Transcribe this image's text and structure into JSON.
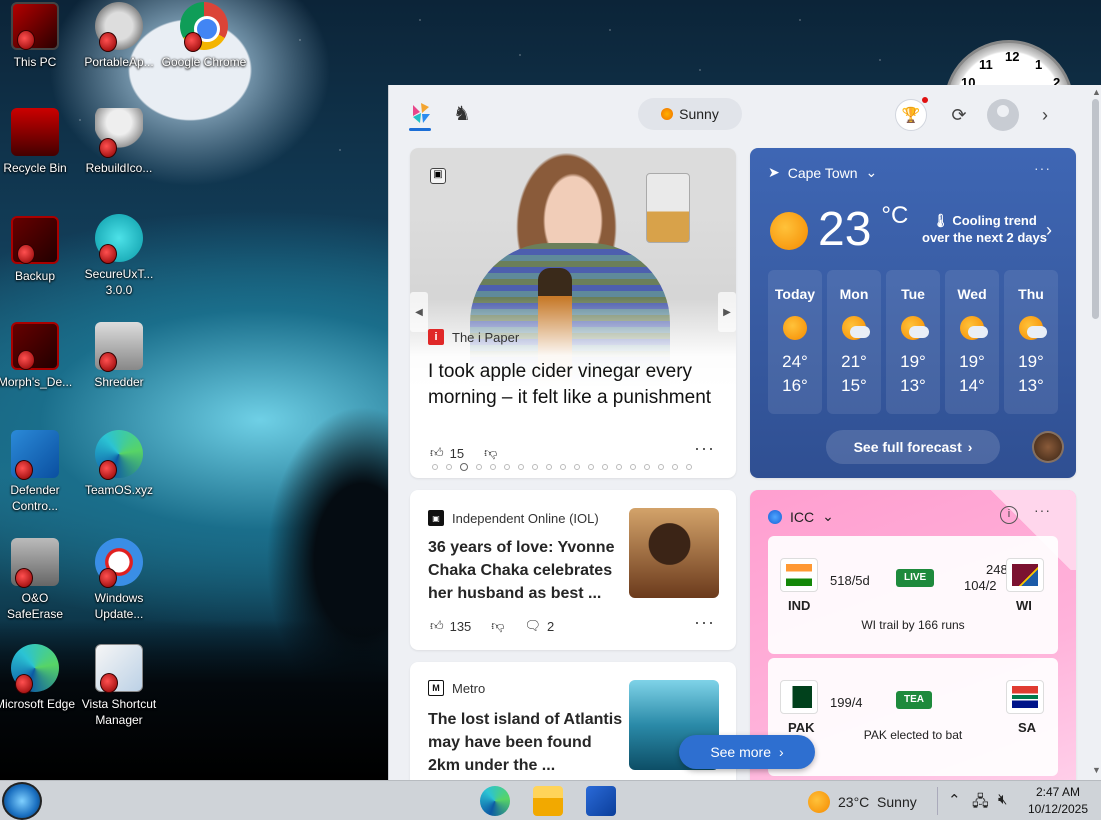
{
  "desktop": {
    "icons": [
      {
        "label": "This PC"
      },
      {
        "label": "PortableAp..."
      },
      {
        "label": "Google Chrome"
      },
      {
        "label": "Recycle Bin"
      },
      {
        "label": "RebuildIco..."
      },
      {
        "label": "Backup"
      },
      {
        "label": "SecureUxT... 3.0.0"
      },
      {
        "label": "Morph's_De..."
      },
      {
        "label": "Shredder"
      },
      {
        "label": "Defender Contro..."
      },
      {
        "label": "TeamOS.xyz"
      },
      {
        "label": "O&O SafeErase"
      },
      {
        "label": "Windows Update..."
      },
      {
        "label": "Microsoft Edge"
      },
      {
        "label": "Vista Shortcut Manager"
      }
    ],
    "clock_numbers": [
      "12",
      "11",
      "1",
      "10",
      "2"
    ]
  },
  "widgets": {
    "topbar": {
      "weather_pill": "Sunny"
    },
    "hero": {
      "source": "The i Paper",
      "headline": "I took apple cider vinegar every morning – it felt like a punishment",
      "likes": "15"
    },
    "weather": {
      "location": "Cape Town",
      "temp": "23",
      "unit": "°C",
      "trend_line1": "Cooling trend",
      "trend_line2": "over the next 2 days",
      "days": [
        {
          "name": "Today",
          "hi": "24°",
          "lo": "16°",
          "icon": "sun"
        },
        {
          "name": "Mon",
          "hi": "21°",
          "lo": "15°",
          "icon": "partly-cloudy"
        },
        {
          "name": "Tue",
          "hi": "19°",
          "lo": "13°",
          "icon": "partly-cloudy"
        },
        {
          "name": "Wed",
          "hi": "19°",
          "lo": "14°",
          "icon": "partly-cloudy"
        },
        {
          "name": "Thu",
          "hi": "19°",
          "lo": "13°",
          "icon": "partly-cloudy"
        }
      ],
      "forecast_button": "See full forecast"
    },
    "news1": {
      "source": "Independent Online (IOL)",
      "headline": "36 years of love: Yvonne Chaka Chaka celebrates her husband as best ...",
      "likes": "135",
      "comments": "2"
    },
    "news2": {
      "source": "Metro",
      "headline": "The lost island of Atlantis may have been found 2km under the ..."
    },
    "icc": {
      "title": "ICC",
      "match1": {
        "team1": "IND",
        "score1": "518/5d",
        "status": "LIVE",
        "team2": "WI",
        "score2": "248",
        "score2b": "104/2",
        "note": "WI trail by 166 runs"
      },
      "match2": {
        "team1": "PAK",
        "score1": "199/4",
        "status": "TEA",
        "team2": "SA",
        "note": "PAK elected to bat"
      }
    },
    "see_more": "See more"
  },
  "taskbar": {
    "weather": "23°C  Sunny",
    "time": "2:47 AM",
    "date": "10/12/2025"
  }
}
